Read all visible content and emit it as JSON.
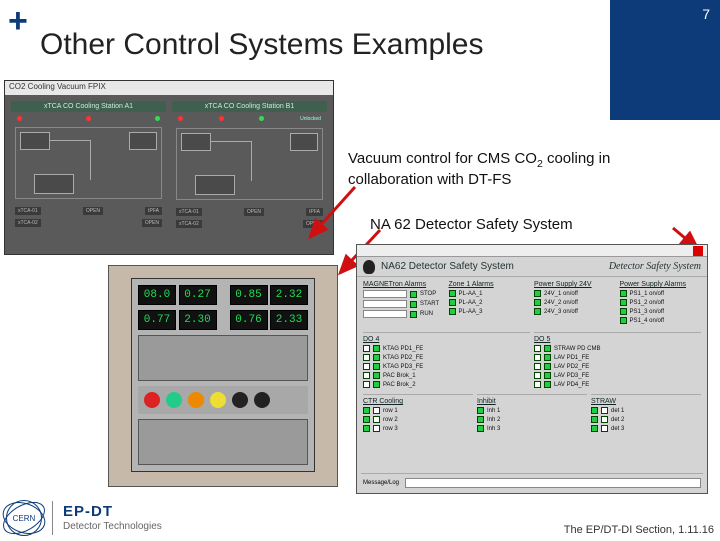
{
  "slide": {
    "number": "7",
    "plus": "+",
    "title": "Other Control Systems Examples"
  },
  "captions": {
    "vacuum_prefix": "Vacuum control for CMS CO",
    "vacuum_sub": "2",
    "vacuum_suffix": " cooling in collaboration with DT-FS",
    "na62": "NA 62 Detector Safety System"
  },
  "scada": {
    "titlebar": "CO2 Cooling Vacuum FPIX",
    "panelA": {
      "head": "xTCA CO Cooling Station A1"
    },
    "panelB": {
      "head": "xTCA CO Cooling Station B1",
      "note": "Unlocked"
    },
    "status": [
      "xTCA-01",
      "OPEN",
      "xTCA-02",
      "OPEN",
      "tPFA"
    ]
  },
  "rack": {
    "row1": [
      "08.0",
      "0.27",
      "0.85",
      "2.32"
    ],
    "row2": [
      "0.77",
      "2.30",
      "0.76",
      "2.33"
    ]
  },
  "dss": {
    "bar": "",
    "title_left": "NA62 Detector Safety System",
    "title_right": "Detector Safety System",
    "sections_top": [
      {
        "h": "MAGNETron Alarms",
        "rows": [
          "STOP",
          "START",
          "RUN"
        ]
      },
      {
        "h": "Zone 1 Alarms",
        "rows": [
          "PL-AA_1",
          "PL-AA_2",
          "PL-AA_3"
        ]
      },
      {
        "h": "Power Supply 24V",
        "rows": [
          "24V_1 on/off",
          "24V_2 on/off",
          "24V_3 on/off"
        ]
      },
      {
        "h": "Power Supply Alarms",
        "rows": [
          "PS1_1 on/off",
          "PS1_2 on/off",
          "PS1_3 on/off",
          "PS1_4 on/off"
        ]
      }
    ],
    "mid_left": {
      "h": "DO 4",
      "rows": [
        "KTAG PD1_FE",
        "KTAG PD2_FE",
        "KTAG PD3_FE",
        "PAC Brok_1",
        "PAC Brok_2"
      ]
    },
    "mid_right": {
      "h": "DO 5",
      "rows": [
        "STRAW PD CMB",
        "LAV PD1_FE",
        "LAV PD2_FE",
        "LAV PD3_FE",
        "LAV PD4_FE"
      ]
    },
    "bot": [
      {
        "h": "CTR Cooling",
        "rows": [
          "row 1",
          "row 2",
          "row 3"
        ]
      },
      {
        "h": "Inhibit",
        "rows": [
          "Inh 1",
          "Inh 2",
          "Inh 3"
        ]
      },
      {
        "h": "STRAW",
        "rows": [
          "det 1",
          "det 2",
          "det 3"
        ]
      }
    ],
    "footer_label": "Message/Log"
  },
  "footer": {
    "cern": "CERN",
    "ep_line1": "EP-DT",
    "ep_line2": "Detector Technologies",
    "right": "The EP/DT-DI Section, 1.11.16"
  }
}
